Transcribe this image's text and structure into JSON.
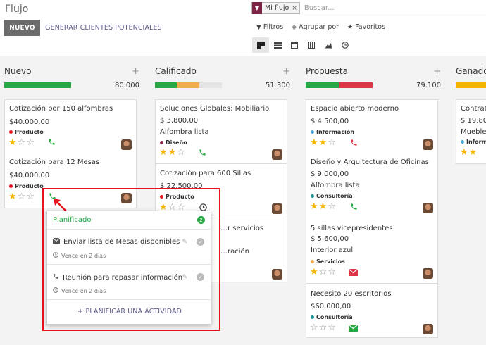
{
  "breadcrumb": "Flujo",
  "buttons": {
    "new": "NUEVO",
    "generate": "GENERAR CLIENTES POTENCIALES"
  },
  "search": {
    "facet": "Mi flujo",
    "facet_remove": "×",
    "placeholder": "Buscar..."
  },
  "filters": {
    "filters": "Filtros",
    "group_by": "Agrupar por",
    "favorites": "Favoritos"
  },
  "colors": {
    "green": "#21b799",
    "progress_green": "#28a745",
    "orange": "#f0ad4e",
    "red": "#dc3545",
    "gold": "#f3b600",
    "popover_green": "#28a745",
    "highlight_red": "#e8121c"
  },
  "columns": [
    {
      "name": "Nuevo",
      "total": "80.000"
    },
    {
      "name": "Calificado",
      "total": "51.300"
    },
    {
      "name": "Propuesta",
      "total": "79.100"
    },
    {
      "name": "Ganado",
      "total": ""
    }
  ],
  "cards": {
    "c1": {
      "title": "Cotización por 150 alfombras",
      "amount": "$40.000,00",
      "tag": "Producto"
    },
    "c2": {
      "title": "Cotización para 12 Mesas",
      "amount": "$40.000,00",
      "tag": "Producto"
    },
    "c3": {
      "title": "Soluciones Globales: Mobiliario",
      "amount": "$ 3.800,00",
      "sub": "Alfombra lista",
      "tag": "Diseño"
    },
    "c4": {
      "title": "Cotización para 600 Sillas",
      "amount": "$ 22.500,00",
      "tag": "Producto"
    },
    "c5": {
      "title": "…r servicios",
      "sub": "…ración"
    },
    "c6": {
      "title": "Espacio abierto moderno",
      "amount": "$ 4.500,00",
      "tag": "Información"
    },
    "c7": {
      "title": "Diseño y Arquitectura de Oficinas",
      "amount": "$ 9.000,00",
      "sub": "Alfombra lista",
      "tag": "Consultoría"
    },
    "c8": {
      "title": "5 sillas vicepresidentes",
      "amount": "$ 5.600,00",
      "sub": "Interior azul",
      "tag": "Servicios"
    },
    "c9": {
      "title": "Necesito 20 escritorios",
      "amount": "$60.000,00",
      "tag": "Consultoría"
    },
    "c10": {
      "title": "Contrat…",
      "amount": "$ 19.800…",
      "sub": "Muebles…",
      "tag": "Informa…"
    }
  },
  "popover": {
    "header": "Planificado",
    "count": "2",
    "items": [
      {
        "title": "Enviar lista de Mesas disponibles",
        "due": "Vence en 2 días"
      },
      {
        "title": "Reunión para repasar información",
        "due": "Vence en 2 días"
      }
    ],
    "plan": "PLANIFICAR UNA ACTIVIDAD"
  }
}
